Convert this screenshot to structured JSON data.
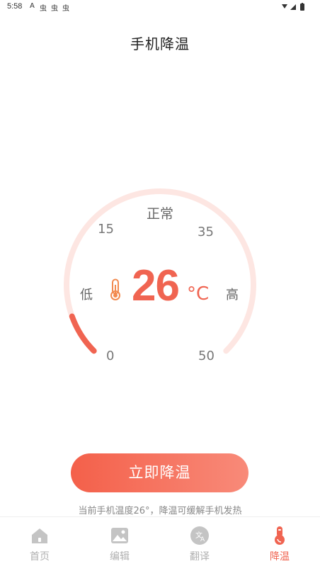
{
  "status_bar": {
    "time": "5:58",
    "notification_icons": [
      "A",
      "虫",
      "虫",
      "虫"
    ]
  },
  "header": {
    "title": "手机降温"
  },
  "gauge": {
    "status_label": "正常",
    "temperature": "26",
    "unit": "°C",
    "temperature_value": 26,
    "scale_min": 0,
    "scale_max": 50,
    "tick_labels": {
      "t0": "0",
      "t15": "15",
      "t35": "35",
      "t50": "50"
    },
    "low_label": "低",
    "high_label": "高",
    "track_color": "#fde6e2",
    "progress_color": "#f06451",
    "icon": "thermometer-icon"
  },
  "action": {
    "button_label": "立即降温",
    "hint": "当前手机温度26°，降温可缓解手机发热"
  },
  "bottom_nav": {
    "items": [
      {
        "label": "首页",
        "icon": "home-icon",
        "active": false
      },
      {
        "label": "编辑",
        "icon": "image-icon",
        "active": false
      },
      {
        "label": "翻译",
        "icon": "translate-icon",
        "active": false
      },
      {
        "label": "降温",
        "icon": "thermometer-icon",
        "active": true
      }
    ]
  },
  "colors": {
    "accent": "#f06451",
    "button_gradient_start": "#f4604a",
    "button_gradient_end": "#f88a79",
    "inactive": "#b0b0b0"
  }
}
